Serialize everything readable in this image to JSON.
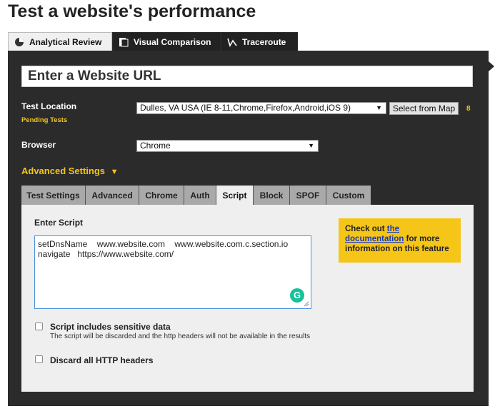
{
  "page_title": "Test a website's performance",
  "main_tabs": [
    {
      "label": "Analytical Review",
      "icon": "analytics-icon",
      "active": true
    },
    {
      "label": "Visual Comparison",
      "icon": "visual-compare-icon",
      "active": false
    },
    {
      "label": "Traceroute",
      "icon": "traceroute-icon",
      "active": false
    }
  ],
  "url_input": {
    "placeholder": "Enter a Website URL"
  },
  "test_location": {
    "label": "Test Location",
    "pending_label": "Pending Tests",
    "selected": "Dulles, VA USA (IE 8-11,Chrome,Firefox,Android,iOS 9)",
    "map_button": "Select from Map",
    "pending_count": "8"
  },
  "browser": {
    "label": "Browser",
    "selected": "Chrome"
  },
  "advanced_settings": {
    "label": "Advanced Settings",
    "arrow": "▼"
  },
  "sub_tabs": [
    {
      "label": "Test Settings",
      "active": false
    },
    {
      "label": "Advanced",
      "active": false
    },
    {
      "label": "Chrome",
      "active": false
    },
    {
      "label": "Auth",
      "active": false
    },
    {
      "label": "Script",
      "active": true
    },
    {
      "label": "Block",
      "active": false
    },
    {
      "label": "SPOF",
      "active": false
    },
    {
      "label": "Custom",
      "active": false
    }
  ],
  "script": {
    "label": "Enter Script",
    "value": "setDnsName    www.website.com    www.website.com.c.section.io\nnavigate   https://www.website.com/"
  },
  "note": {
    "prefix": "Check out ",
    "link": "the documentation",
    "suffix": " for more information on this feature"
  },
  "options": {
    "sensitive_label": "Script includes sensitive data",
    "sensitive_help": "The script will be discarded and the http headers will not be available in the results",
    "discard_label": "Discard all HTTP headers"
  },
  "colors": {
    "accent": "#f5c518",
    "panel": "#2b2b2b",
    "link": "#1a3cbb"
  }
}
